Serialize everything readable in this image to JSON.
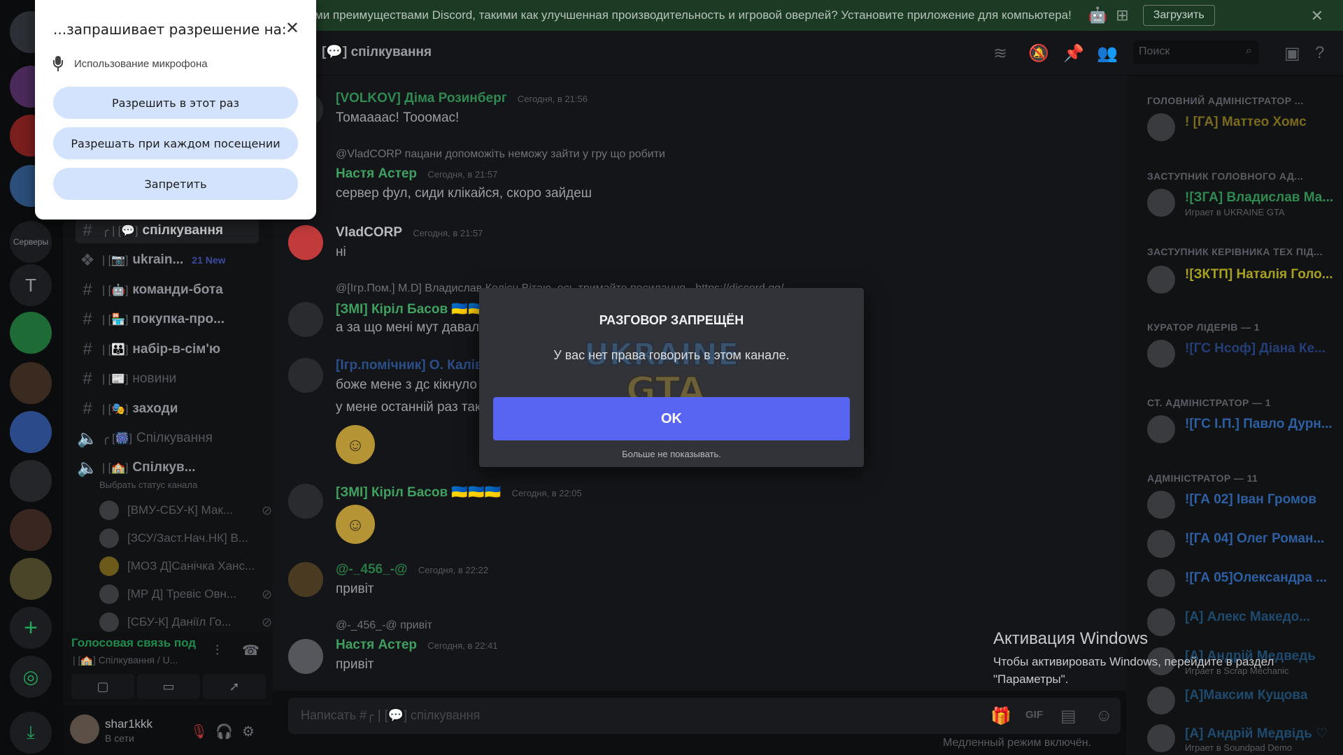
{
  "banner": {
    "text": "ми преимуществами Discord, такими как улучшенная производительность и игровой оверлей? Установите приложение для компьютера!",
    "download_label": "Загрузить",
    "os_icons": [
      "apple-icon",
      "android-icon",
      "windows-icon"
    ]
  },
  "permission_popup": {
    "title": "...запрашивает разрешение на:",
    "permission": "Использование микрофона",
    "allow_once": "Разрешить в этот раз",
    "allow_always": "Разрешать при каждом посещении",
    "deny": "Запретить"
  },
  "servers": {
    "label": "Серверы",
    "text_server": "T"
  },
  "channels": [
    {
      "deco": "╭ | [💬]",
      "name": "спілкування",
      "active": true
    },
    {
      "deco": "| [📷]",
      "name": "ukrain...",
      "badge": "21 New"
    },
    {
      "deco": "| [🤖]",
      "name": "команди-бота"
    },
    {
      "deco": "| [🏪]",
      "name": "покупка-про..."
    },
    {
      "deco": "| [👪]",
      "name": "набір-в-сім'ю"
    },
    {
      "deco": "| [📰]",
      "name": "новини",
      "dim": true
    },
    {
      "deco": "| [🎭]",
      "name": "заходи"
    },
    {
      "deco": "╭ [🎆]",
      "name": "Спілкування",
      "dim": true
    },
    {
      "deco": "| [🏫]",
      "name": "Спілкув..."
    }
  ],
  "channel_status": "Выбрать статус канала",
  "voice_users": [
    "[ВМУ-СБУ-К] Мак...",
    "[ЗСУ/Заст.Нач.НК] В...",
    "[МОЗ Д]Санічка Ханс...",
    "[МР Д] Тревіс Овн...",
    "[СБУ-К] Даніїл Го..."
  ],
  "voice_panel": {
    "title": "Голосовая связь под",
    "subtitle": "| [🏫] Спілкування / U..."
  },
  "user_panel": {
    "name": "shar1kkk",
    "status": "В сети"
  },
  "chat_header": {
    "title": "[💬] спілкування",
    "search_placeholder": "Поиск"
  },
  "messages": [
    {
      "author": "[VOLKOV] Діма Розинберг",
      "author_color": "#2f8a52",
      "time": "Сегодня, в 21:56",
      "text": "Томаааас! Тооомас!"
    },
    {
      "reply": "@VladCORP пацани допоможіть неможу зайти у гру що робити",
      "author": "Настя Астер",
      "author_color": "#3fa060",
      "time": "Сегодня, в 21:57",
      "text": "сервер фул, сиди клікайся, скоро зайдеш"
    },
    {
      "author": "VladCORP",
      "author_color": "#b7babf",
      "time": "Сегодня, в 21:57",
      "text": "ні"
    },
    {
      "reply": "@[Ігр.Пом.] М.D] Владислав Колісн Вітаю, ось тримайте посилання - https://discord.gg/...",
      "author": "[ЗМІ] Кірiл Басов 🇺🇦🇺🇦🇺🇦",
      "author_color": "#3fa060",
      "time": "",
      "text": "а за що мені мут давали"
    },
    {
      "author": "[Ігр.помічник] О. Калів...",
      "author_color": "#2a4f8a",
      "time": "",
      "text": "боже мене з дс кікнуло",
      "text2": "у мене останній раз так"
    },
    {
      "author": "[ЗМІ] Кірiл Басов 🇺🇦🇺🇦🇺🇦",
      "author_color": "#3fa060",
      "time": "Сегодня, в 22:05",
      "text": ""
    },
    {
      "author": "@-_456_-@",
      "author_color": "#2a7a45",
      "time": "Сегодня, в 22:22",
      "text": "привіт"
    },
    {
      "reply": "@-_456_-@ привіт",
      "author": "Настя Астер",
      "author_color": "#3fa060",
      "time": "Сегодня, в 22:41",
      "text": "привіт"
    }
  ],
  "input": {
    "placeholder": "Написать #╭ | [💬] спілкування",
    "slowmode": "Медленный режим включён."
  },
  "members": {
    "roles": [
      "ГОЛОВНИЙ АДМІНІСТРАТОР ...",
      "ЗАСТУПНИК ГОЛОВНОГО АД...",
      "ЗАСТУПНИК КЕРІВНИКА ТЕХ ПІД...",
      "КУРАТОР ЛІДЕРІВ — 1",
      "СТ. АДМІНІСТРАТОР — 1",
      "АДМІНІСТРАТОР — 11"
    ],
    "list": [
      {
        "name": "! [ГА] Маттео Хомс",
        "color": "#7a6a1e"
      },
      {
        "name": "![ЗГА] Владислав Ма...",
        "color": "#2f8a52",
        "activity": "Играет в UKRAINE GTA"
      },
      {
        "name": "![ЗКТП] Наталія Голо...",
        "color": "#a8a01f"
      },
      {
        "name": "![ГС Нсоф] Діана Ке...",
        "color": "#243e78"
      },
      {
        "name": "![ГС І.П.] Павло Дурн...",
        "color": "#2d5fa3"
      },
      {
        "name": "![ГА 02] Іван Громов",
        "color": "#2d5fa3"
      },
      {
        "name": "![ГА 04] Олег Роман...",
        "color": "#2d5fa3"
      },
      {
        "name": "![ГА 05]Олександра ...",
        "color": "#2d5fa3"
      },
      {
        "name": "[А] Алекс Македо...",
        "color": "#1e4a6e"
      },
      {
        "name": "[А] Андрій Медведь",
        "color": "#1e4a6e",
        "activity": "Играет в Scrap Mechanic"
      },
      {
        "name": "[А]Максим Кущова",
        "color": "#1e4a6e"
      },
      {
        "name": "[А] Андрій Медвідь ♡",
        "color": "#1e4a6e",
        "activity": "Играет в Soundpad Demo"
      }
    ]
  },
  "modal": {
    "title": "РАЗГОВОР ЗАПРЕЩЁН",
    "body": "У вас нет права говорить в этом канале.",
    "ok": "OK",
    "dont_show": "Больше не показывать."
  },
  "windows_activation": {
    "title": "Активация Windows",
    "body": "Чтобы активировать Windows, перейдите в раздел \"Параметры\"."
  }
}
